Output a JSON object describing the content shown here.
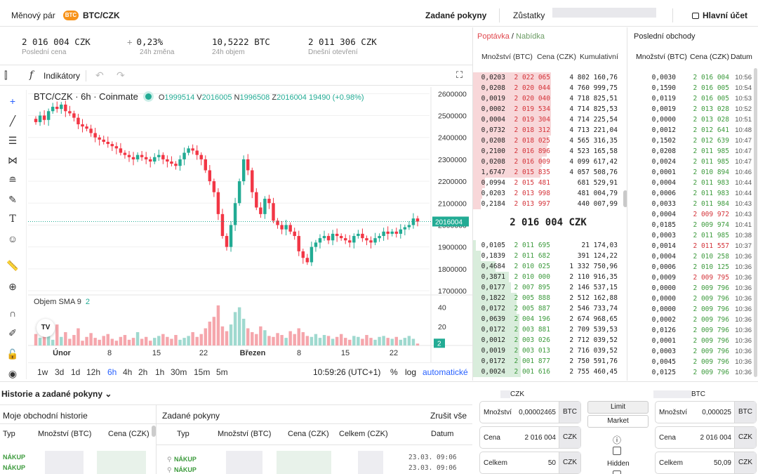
{
  "topbar": {
    "pair_label": "Měnový pár",
    "coin_icon": "bitcoin-icon",
    "coin_badge": "BTC",
    "pair": "BTC/CZK",
    "orders_tab": "Zadané pokyny",
    "balances": "Zůstatky",
    "account": "Hlavní účet"
  },
  "stats": [
    {
      "value": "2 016 004 CZK",
      "label": "Poslední cena"
    },
    {
      "value": "0,23%",
      "label": "24h změna"
    },
    {
      "value": "10,5222 BTC",
      "label": "24h objem"
    },
    {
      "value": "2 011 306 CZK",
      "label": "Dnešní otevření"
    }
  ],
  "chart_toolbar": {
    "indicators": "Indikátory"
  },
  "chart": {
    "header": "BTC/CZK · 6h · Coinmate",
    "o": "1999514",
    "h": "2016005",
    "l": "1996508",
    "c": "2016004",
    "change": "19490 (+0.98%)",
    "volume_label": "Objem SMA 9",
    "volume_value": "2",
    "last_price_label": "2016004",
    "volume_last_label": "2",
    "logo": "TV"
  },
  "chart_data": {
    "type": "candlestick",
    "y_ticks": [
      2600000,
      2500000,
      2400000,
      2300000,
      2200000,
      2100000,
      2000000,
      1900000,
      1800000,
      1700000
    ],
    "y_range": [
      1700000,
      2630000
    ],
    "volume_ticks": [
      40,
      20
    ],
    "x_labels": [
      "Únor",
      "8",
      "15",
      "22",
      "Březen",
      "8",
      "15",
      "22"
    ],
    "last_price": 2016004,
    "closes": [
      2470000,
      2500000,
      2480000,
      2520000,
      2540000,
      2530000,
      2550000,
      2520000,
      2510000,
      2490000,
      2460000,
      2450000,
      2440000,
      2420000,
      2400000,
      2390000,
      2380000,
      2370000,
      2360000,
      2350000,
      2330000,
      2320000,
      2310000,
      2300000,
      2320000,
      2310000,
      2300000,
      2290000,
      2310000,
      2320000,
      2300000,
      2290000,
      2280000,
      2270000,
      2300000,
      2330000,
      2350000,
      2340000,
      2320000,
      2300000,
      2250000,
      2200000,
      2150000,
      2050000,
      1950000,
      1900000,
      2000000,
      2100000,
      2200000,
      2300000,
      2250000,
      2150000,
      2080000,
      2050000,
      2120000,
      2100000,
      2020000,
      2000000,
      1980000,
      2000000,
      1970000,
      1950000,
      1880000,
      1850000,
      1830000,
      1900000,
      1920000,
      1940000,
      1950000,
      1930000,
      1960000,
      1950000,
      1940000,
      1930000,
      1920000,
      1950000,
      1960000,
      1940000,
      1930000,
      1920000,
      1940000,
      1950000,
      1970000,
      1960000,
      1970000,
      1960000,
      1980000,
      1990000,
      2000000,
      2030000,
      2016004
    ],
    "volumes": [
      12,
      8,
      15,
      10,
      6,
      22,
      9,
      14,
      7,
      11,
      18,
      5,
      9,
      13,
      8,
      6,
      10,
      12,
      7,
      5,
      9,
      11,
      6,
      8,
      14,
      7,
      9,
      5,
      8,
      10,
      12,
      9,
      7,
      11,
      6,
      8,
      10,
      14,
      9,
      12,
      18,
      25,
      30,
      42,
      20,
      15,
      22,
      35,
      40,
      28,
      18,
      14,
      12,
      20,
      16,
      10,
      9,
      13,
      11,
      8,
      15,
      12,
      18,
      14,
      10,
      9,
      12,
      8,
      11,
      10,
      7,
      9,
      12,
      8,
      6,
      10,
      9,
      7,
      11,
      8,
      6,
      9,
      10,
      8,
      7,
      9,
      6,
      8,
      10,
      7,
      2
    ]
  },
  "timeframes": [
    "1w",
    "3d",
    "1d",
    "12h",
    "6h",
    "4h",
    "2h",
    "1h",
    "30m",
    "15m",
    "5m"
  ],
  "time_bar": {
    "clock": "10:59:26 (UTC+1)",
    "percent": "%",
    "log": "log",
    "auto": "automatické"
  },
  "orderbook": {
    "title_ask": "Poptávka",
    "title_sep": " / ",
    "title_bid": "Nabídka",
    "col_qty": "Množství (BTC)",
    "col_price": "Cena (CZK)",
    "col_cum": "Kumulativní",
    "spread": "2 016 004 CZK",
    "asks": [
      [
        "0,0203",
        "2 022 065",
        "4 802 160,76",
        0.52
      ],
      [
        "0,0208",
        "2 020 044",
        "4 760 999,75",
        0.52
      ],
      [
        "0,0019",
        "2 020 040",
        "4 718 825,51",
        0.52
      ],
      [
        "0,0002",
        "2 019 534",
        "4 714 825,53",
        0.52
      ],
      [
        "0,0004",
        "2 019 304",
        "4 714 225,54",
        0.52
      ],
      [
        "0,0732",
        "2 018 312",
        "4 713 221,04",
        0.52
      ],
      [
        "0,0208",
        "2 018 025",
        "4 565 316,35",
        0.5
      ],
      [
        "0,2100",
        "2 016 896",
        "4 523 165,58",
        0.49
      ],
      [
        "0,0208",
        "2 016 009",
        "4 099 617,42",
        0.46
      ],
      [
        "1,6747",
        "2 015 835",
        "4 057 508,76",
        0.45
      ],
      [
        "0,0994",
        "2 015 481",
        "681 529,91",
        0.08
      ],
      [
        "0,0203",
        "2 013 998",
        "481 004,79",
        0.06
      ],
      [
        "0,2184",
        "2 013 997",
        "440 007,99",
        0.05
      ]
    ],
    "bids": [
      [
        "0,0105",
        "2 011 695",
        "21 174,03",
        0.02
      ],
      [
        "0,1839",
        "2 011 682",
        "391 124,22",
        0.05
      ],
      [
        "0,4684",
        "2 010 025",
        "1 332 750,96",
        0.15
      ],
      [
        "0,3871",
        "2 010 000",
        "2 110 916,35",
        0.24
      ],
      [
        "0,0177",
        "2 007 895",
        "2 146 537,15",
        0.25
      ],
      [
        "0,1822",
        "2 005 888",
        "2 512 162,88",
        0.29
      ],
      [
        "0,0172",
        "2 005 887",
        "2 546 733,74",
        0.29
      ],
      [
        "0,0639",
        "2 004 196",
        "2 674 968,65",
        0.31
      ],
      [
        "0,0172",
        "2 003 881",
        "2 709 539,53",
        0.31
      ],
      [
        "0,0012",
        "2 003 026",
        "2 712 039,52",
        0.31
      ],
      [
        "0,0019",
        "2 003 013",
        "2 716 039,52",
        0.31
      ],
      [
        "0,0172",
        "2 001 877",
        "2 750 591,76",
        0.32
      ],
      [
        "0,0024",
        "2 001 616",
        "2 755 460,45",
        0.32
      ]
    ]
  },
  "trades": {
    "title": "Poslední obchody",
    "col_qty": "Množství (BTC)",
    "col_price": "Cena (CZK)",
    "col_time": "Datum",
    "green": "#3c9a3c",
    "red": "#d4343a",
    "rows": [
      [
        "0,0030",
        "2 016 004",
        "10:56",
        "g"
      ],
      [
        "0,1590",
        "2 016 005",
        "10:54",
        "g"
      ],
      [
        "0,0119",
        "2 016 005",
        "10:53",
        "g"
      ],
      [
        "0,0019",
        "2 013 028",
        "10:52",
        "g"
      ],
      [
        "0,0000",
        "2 013 028",
        "10:51",
        "g"
      ],
      [
        "0,0012",
        "2 012 641",
        "10:48",
        "g"
      ],
      [
        "0,1502",
        "2 012 639",
        "10:47",
        "g"
      ],
      [
        "0,0208",
        "2 011 985",
        "10:47",
        "g"
      ],
      [
        "0,0024",
        "2 011 985",
        "10:47",
        "g"
      ],
      [
        "0,0001",
        "2 010 894",
        "10:46",
        "g"
      ],
      [
        "0,0004",
        "2 011 983",
        "10:44",
        "g"
      ],
      [
        "0,0006",
        "2 011 983",
        "10:44",
        "g"
      ],
      [
        "0,0033",
        "2 011 984",
        "10:43",
        "g"
      ],
      [
        "0,0004",
        "2 009 972",
        "10:43",
        "r"
      ],
      [
        "0,0185",
        "2 009 974",
        "10:41",
        "g"
      ],
      [
        "0,0003",
        "2 011 985",
        "10:38",
        "g"
      ],
      [
        "0,0014",
        "2 011 557",
        "10:37",
        "r"
      ],
      [
        "0,0004",
        "2 010 258",
        "10:36",
        "g"
      ],
      [
        "0,0006",
        "2 010 125",
        "10:36",
        "g"
      ],
      [
        "0,0009",
        "2 009 795",
        "10:36",
        "r"
      ],
      [
        "0,0000",
        "2 009 796",
        "10:36",
        "g"
      ],
      [
        "0,0000",
        "2 009 796",
        "10:36",
        "g"
      ],
      [
        "0,0000",
        "2 009 796",
        "10:36",
        "g"
      ],
      [
        "0,0002",
        "2 009 796",
        "10:36",
        "g"
      ],
      [
        "0,0126",
        "2 009 796",
        "10:36",
        "g"
      ],
      [
        "0,0001",
        "2 009 796",
        "10:36",
        "g"
      ],
      [
        "0,0003",
        "2 009 796",
        "10:36",
        "g"
      ],
      [
        "0,0045",
        "2 009 796",
        "10:36",
        "g"
      ],
      [
        "0,0125",
        "2 009 796",
        "10:36",
        "g"
      ]
    ]
  },
  "history": {
    "title": "Historie a zadané pokyny",
    "my_history": "Moje obchodní historie",
    "my_cols": [
      "Typ",
      "Množství (BTC)",
      "Cena (CZK)"
    ],
    "orders": "Zadané pokyny",
    "cancel_all": "Zrušit vše",
    "order_cols": [
      "Typ",
      "Množství (BTC)",
      "Cena (CZK)",
      "Celkem (CZK)",
      "Datum"
    ],
    "my_rows": [
      "NÁKUP",
      "NÁKUP"
    ],
    "order_rows": [
      {
        "type": "NÁKUP",
        "date": "23.03. 09:06"
      },
      {
        "type": "NÁKUP",
        "date": "23.03. 09:06"
      }
    ]
  },
  "trade_form": {
    "left_currency": "CZK",
    "right_currency": "BTC",
    "buy": {
      "qty_label": "Množství",
      "qty": "0,00002465",
      "qty_unit": "BTC",
      "price_label": "Cena",
      "price": "2 016 004",
      "price_unit": "CZK",
      "total_label": "Celkem",
      "total": "50",
      "total_unit": "CZK"
    },
    "sell": {
      "qty_label": "Množství",
      "qty": "0,000025",
      "qty_unit": "BTC",
      "price_label": "Cena",
      "price": "2 016 004",
      "price_unit": "CZK",
      "total_label": "Celkem",
      "total": "50,09",
      "total_unit": "CZK"
    },
    "limit": "Limit",
    "market": "Market",
    "hidden": "Hidden",
    "info_icon": "info-icon"
  },
  "colors": {
    "up": "#22ab94",
    "down": "#f23645",
    "ask_bar": "#f8d7d9",
    "bid_bar": "#d9eddc",
    "ask_price": "#d4343a",
    "bid_price": "#3c9a3c",
    "accent": "#2962ff"
  }
}
